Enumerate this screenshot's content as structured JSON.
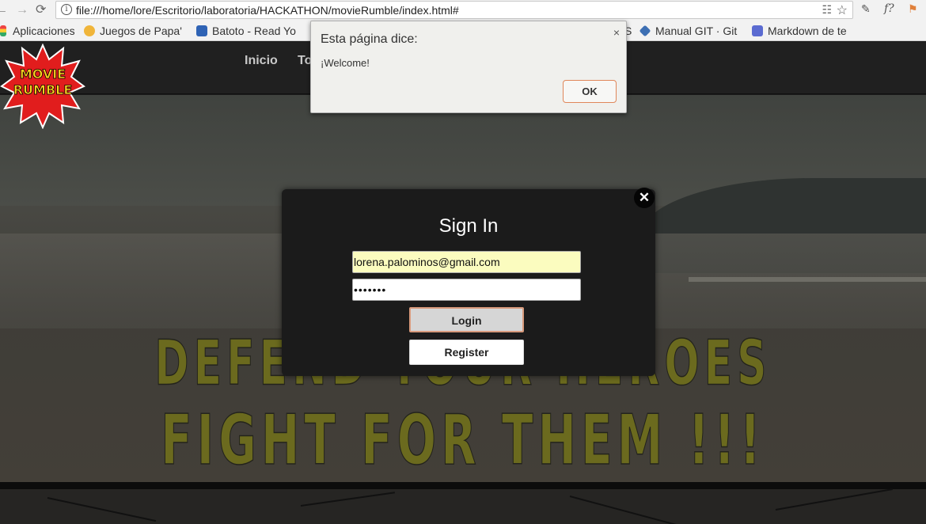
{
  "browser": {
    "back_icon": "←",
    "forward_icon": "→",
    "reload_icon": "⟳",
    "url": "file:///home/lore/Escritorio/laboratoria/HACKATHON/movieRumble/index.html#",
    "bookmarks": [
      {
        "label": "Aplicaciones",
        "color": "#e8a33b"
      },
      {
        "label": "Juegos de Papa'",
        "color": "#f0b53a"
      },
      {
        "label": "Batoto - Read Yo",
        "color": "#2f63b5"
      },
      {
        "label": "S",
        "color": "#4f8fd6"
      },
      {
        "label": "Manual GIT · Git",
        "color": "#3d6fb3"
      },
      {
        "label": "Markdown de te",
        "color": "#5b6bd1"
      }
    ]
  },
  "site": {
    "logo_line1": "MOVIE",
    "logo_line2": "RUMBLE",
    "nav": [
      "Inicio",
      "To"
    ],
    "slogan_line1": "DEFEND YOUR HEROES",
    "slogan_line2": "FIGHT FOR THEM !!!"
  },
  "alert": {
    "title": "Esta página dice:",
    "message": "¡Welcome!",
    "ok_label": "OK",
    "close_icon": "×"
  },
  "signin": {
    "title": "Sign In",
    "email_value": "lorena.palominos@gmail.com",
    "password_value": "•••••••",
    "login_label": "Login",
    "register_label": "Register",
    "close_icon": "✕"
  },
  "colors": {
    "slogan": "#6b6a1e",
    "modal_bg": "#1b1b1b",
    "email_autofill": "#fbfcbf"
  }
}
